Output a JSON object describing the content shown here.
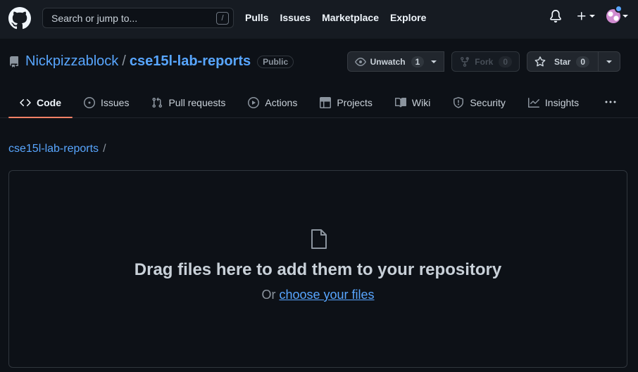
{
  "header": {
    "search_placeholder": "Search or jump to...",
    "search_shortcut": "/",
    "nav": [
      "Pulls",
      "Issues",
      "Marketplace",
      "Explore"
    ],
    "icons": [
      "github-logo-icon",
      "bell-icon",
      "plus-icon",
      "avatar"
    ]
  },
  "repo": {
    "owner": "Nickpizzablock",
    "separator": "/",
    "name": "cse15l-lab-reports",
    "visibility": "Public",
    "unwatch_label": "Unwatch",
    "watch_count": "1",
    "fork_label": "Fork",
    "fork_count": "0",
    "star_label": "Star",
    "star_count": "0"
  },
  "tabs": [
    {
      "label": "Code",
      "icon": "code-icon",
      "active": true
    },
    {
      "label": "Issues",
      "icon": "issue-icon"
    },
    {
      "label": "Pull requests",
      "icon": "pull-request-icon"
    },
    {
      "label": "Actions",
      "icon": "play-icon"
    },
    {
      "label": "Projects",
      "icon": "table-icon"
    },
    {
      "label": "Wiki",
      "icon": "book-icon"
    },
    {
      "label": "Security",
      "icon": "shield-icon"
    },
    {
      "label": "Insights",
      "icon": "graph-icon"
    }
  ],
  "breadcrumb": {
    "repo": "cse15l-lab-reports",
    "slash": "/"
  },
  "dropzone": {
    "title": "Drag files here to add them to your repository",
    "prefix": "Or",
    "link": "choose your files"
  },
  "colors": {
    "background": "#0d1117",
    "header": "#161b22",
    "link": "#58a6ff",
    "active_tab_underline": "#f78166"
  }
}
